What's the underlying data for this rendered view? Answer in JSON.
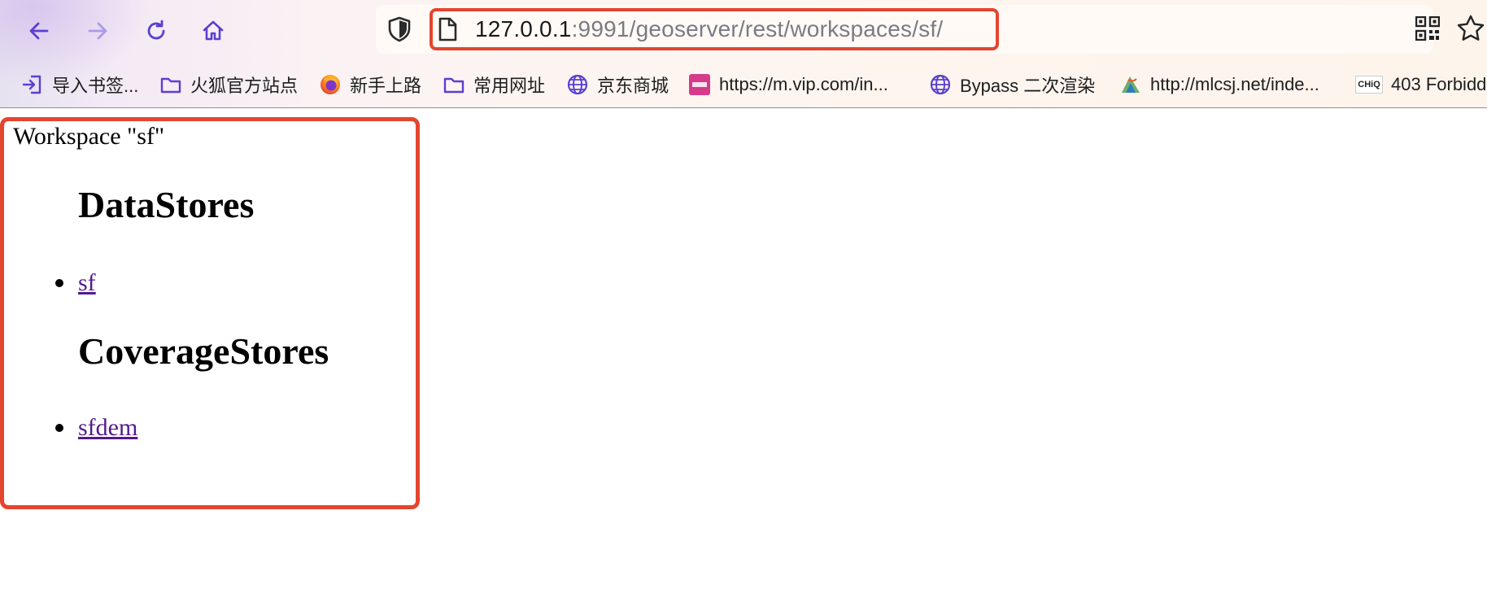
{
  "browser": {
    "url_host": "127.0.0.1",
    "url_rest": ":9991/geoserver/rest/workspaces/sf/"
  },
  "bookmarks": [
    {
      "label": "导入书签...",
      "icon": "import-icon"
    },
    {
      "label": "火狐官方站点",
      "icon": "folder-icon"
    },
    {
      "label": "新手上路",
      "icon": "firefox-icon"
    },
    {
      "label": "常用网址",
      "icon": "folder-icon"
    },
    {
      "label": "京东商城",
      "icon": "globe-icon"
    },
    {
      "label": "https://m.vip.com/in...",
      "icon": "vip-icon"
    },
    {
      "label": "Bypass 二次渲染",
      "icon": "globe-icon"
    },
    {
      "label": "http://mlcsj.net/inde...",
      "icon": "site-icon"
    },
    {
      "label": "403 Forbidd",
      "icon": "chiq-icon",
      "icon_text": "CHiQ"
    }
  ],
  "page": {
    "workspace_title": "Workspace \"sf\"",
    "datastores_heading": "DataStores",
    "datastores": [
      "sf"
    ],
    "coveragestores_heading": "CoverageStores",
    "coveragestores": [
      "sfdem"
    ]
  },
  "colors": {
    "highlight": "#e4452e",
    "link_visited": "#551a8b",
    "nav_icon": "#5b3fd1"
  }
}
